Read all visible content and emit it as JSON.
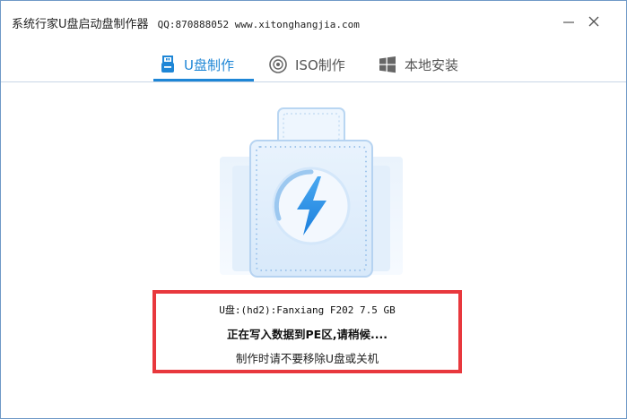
{
  "window": {
    "title": "系统行家U盘启动盘制作器",
    "contact": "QQ:870888052 www.xitonghangjia.com",
    "minimize_symbol": "—",
    "close_symbol": "✕"
  },
  "tabs": [
    {
      "label": "U盘制作",
      "icon": "usb-drive-icon",
      "active": true
    },
    {
      "label": "ISO制作",
      "icon": "disc-icon",
      "active": false
    },
    {
      "label": "本地安装",
      "icon": "windows-logo-icon",
      "active": false
    }
  ],
  "illustration": {
    "icon": "usb-lightning-icon"
  },
  "status": {
    "device": "U盘:(hd2):Fanxiang F202 7.5 GB",
    "progress": "正在写入数据到PE区,请稍候....",
    "warning": "制作时请不要移除U盘或关机"
  },
  "colors": {
    "accent": "#1e86d6",
    "highlight_border": "#e8383d",
    "window_border": "#6f99c7"
  }
}
